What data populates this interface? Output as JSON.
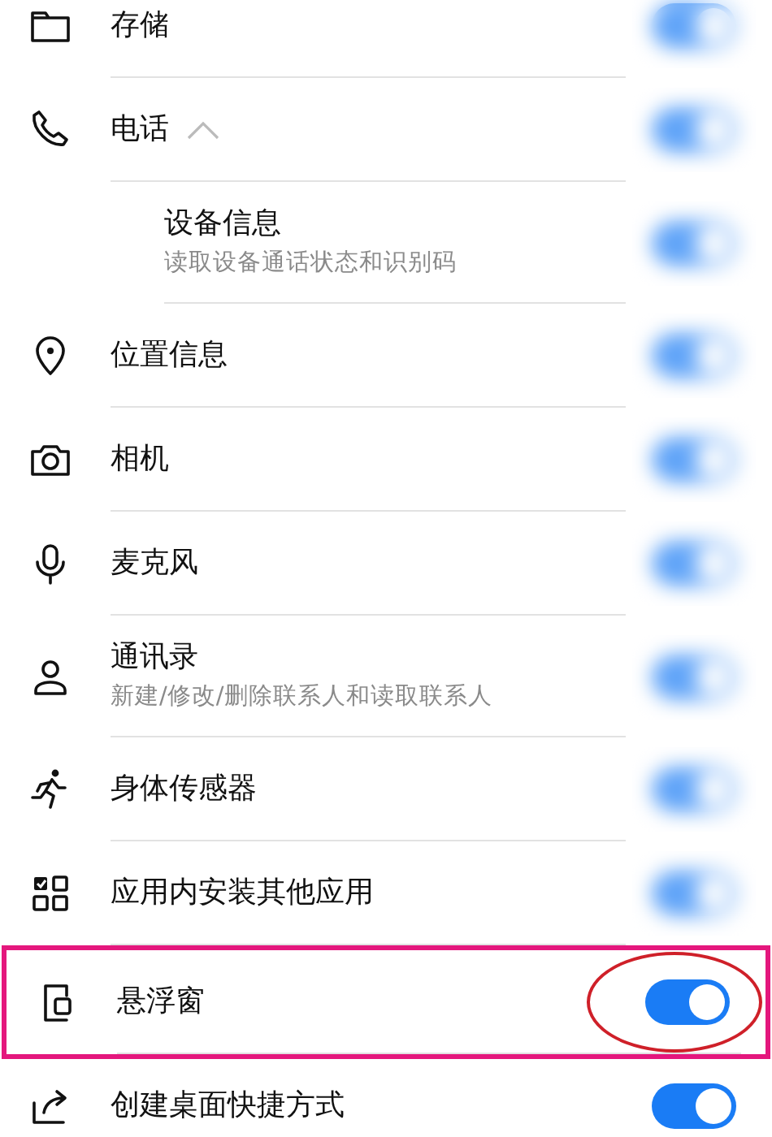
{
  "permissions": [
    {
      "title": "存储",
      "on": true,
      "blurred": true
    },
    {
      "title": "电话",
      "on": true,
      "blurred": true,
      "expanded": true,
      "children": [
        {
          "title": "设备信息",
          "subtitle": "读取设备通话状态和识别码",
          "on": true,
          "blurred": true
        }
      ]
    },
    {
      "title": "位置信息",
      "on": true,
      "blurred": true
    },
    {
      "title": "相机",
      "on": true,
      "blurred": true
    },
    {
      "title": "麦克风",
      "on": true,
      "blurred": true
    },
    {
      "title": "通讯录",
      "subtitle": "新建/修改/删除联系人和读取联系人",
      "on": true,
      "blurred": true
    },
    {
      "title": "身体传感器",
      "on": true,
      "blurred": true
    },
    {
      "title": "应用内安装其他应用",
      "on": true,
      "blurred": true
    },
    {
      "title": "悬浮窗",
      "on": true,
      "blurred": false,
      "highlighted": true,
      "circled": true
    },
    {
      "title": "创建桌面快捷方式",
      "on": true,
      "blurred": false
    }
  ]
}
